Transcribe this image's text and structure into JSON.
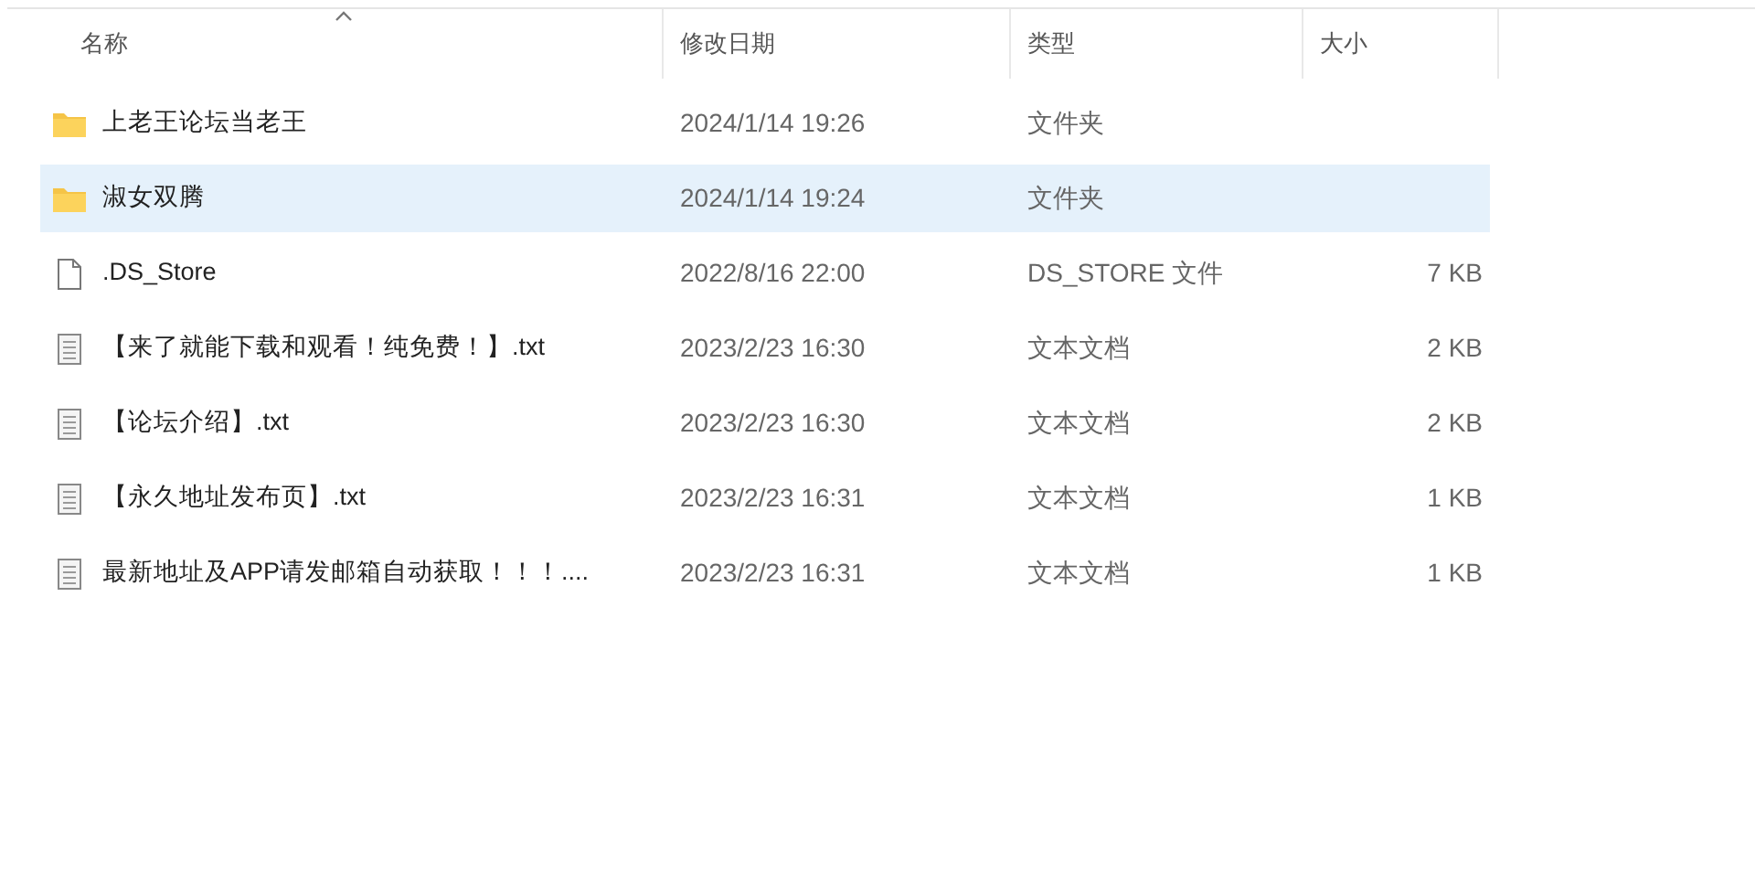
{
  "columns": [
    {
      "label": "名称",
      "sorted": true
    },
    {
      "label": "修改日期",
      "sorted": false
    },
    {
      "label": "类型",
      "sorted": false
    },
    {
      "label": "大小",
      "sorted": false
    }
  ],
  "rows": [
    {
      "kind": "folder",
      "name": "上老王论坛当老王",
      "modified": "2024/1/14 19:26",
      "type": "文件夹",
      "selected": false
    },
    {
      "kind": "folder",
      "name": "淑女双腾",
      "modified": "2024/1/14 19:24",
      "type": "文件夹",
      "selected": true
    },
    {
      "kind": "file",
      "name": ".DS_Store",
      "modified": "2022/8/16 22:00",
      "type": "DS_STORE 文件",
      "size": "7 KB",
      "selected": false
    },
    {
      "kind": "text",
      "name": "【来了就能下载和观看！纯免费！】.txt",
      "modified": "2023/2/23 16:30",
      "type": "文本文档",
      "size": "2 KB",
      "selected": false
    },
    {
      "kind": "text",
      "name": "【论坛介绍】.txt",
      "modified": "2023/2/23 16:30",
      "type": "文本文档",
      "size": "2 KB",
      "selected": false
    },
    {
      "kind": "text",
      "name": "【永久地址发布页】.txt",
      "modified": "2023/2/23 16:31",
      "type": "文本文档",
      "size": "1 KB",
      "selected": false
    },
    {
      "kind": "text",
      "name": "最新地址及APP请发邮箱自动获取！！！....",
      "modified": "2023/2/23 16:31",
      "type": "文本文档",
      "size": "1 KB",
      "selected": false
    }
  ]
}
